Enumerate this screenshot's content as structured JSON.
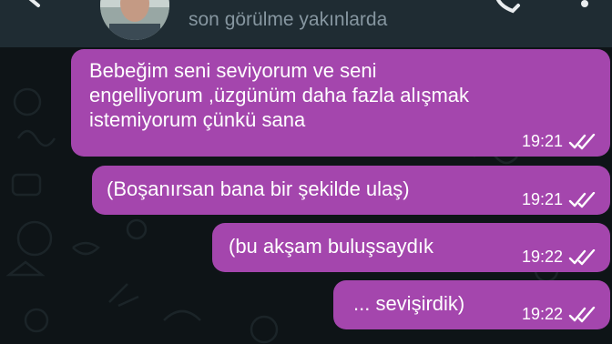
{
  "header": {
    "status_text": "son görülme yakınlarda"
  },
  "messages": [
    {
      "text": "Bebeğim seni seviyorum ve seni\nengelliyorum ,üzgünüm daha fazla alışmak\nistemiyorum çünkü sana",
      "time": "19:21",
      "status": "read"
    },
    {
      "text": "(Boşanırsan bana bir şekilde ulaş)",
      "time": "19:21",
      "status": "read"
    },
    {
      "text": "(bu akşam buluşsaydık",
      "time": "19:22",
      "status": "read"
    },
    {
      "text": "... sevişirdik)",
      "time": "19:22",
      "status": "read"
    }
  ],
  "colors": {
    "header_bg": "#1f2c33",
    "chat_bg": "#0e1417",
    "bubble_bg": "#a446ad",
    "status_text": "#8696a0"
  },
  "icons": [
    "back-arrow-icon",
    "phone-call-icon",
    "more-options-icon",
    "double-check-icon"
  ]
}
